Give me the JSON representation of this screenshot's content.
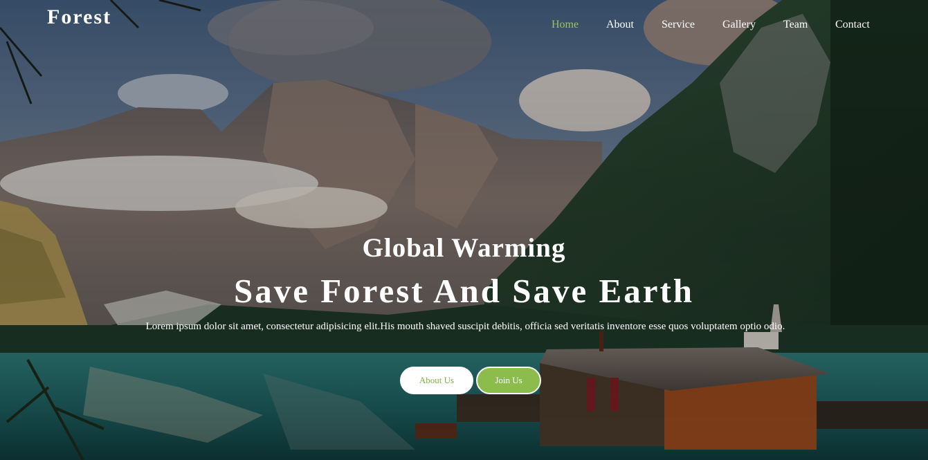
{
  "brand": {
    "name": "Forest"
  },
  "nav": {
    "items": [
      {
        "label": "Home",
        "active": true
      },
      {
        "label": "About",
        "active": false
      },
      {
        "label": "Service",
        "active": false
      },
      {
        "label": "Gallery",
        "active": false
      },
      {
        "label": "Team",
        "active": false
      },
      {
        "label": "Contact",
        "active": false
      }
    ]
  },
  "hero": {
    "kicker": "Global Warming",
    "title": "Save Forest And Save Earth",
    "description": "Lorem ipsum dolor sit amet, consectetur adipisicing elit.His mouth shaved suscipit debitis, officia sed veritatis inventore esse quos voluptatem optio odio.",
    "buttons": {
      "about_label": "About Us",
      "join_label": "Join Us"
    }
  },
  "colors": {
    "accent": "#8cbc4c",
    "active_nav": "#9cc45a",
    "text": "#ffffff"
  }
}
